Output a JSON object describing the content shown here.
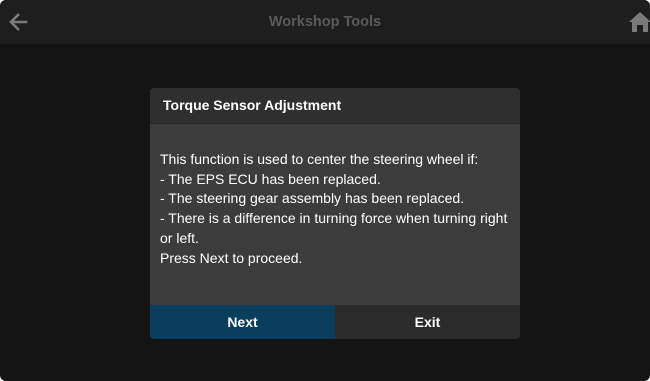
{
  "header": {
    "title": "Workshop Tools",
    "back_icon": "arrow-left-icon",
    "home_icon": "home-icon"
  },
  "dialog": {
    "title": "Torque Sensor Adjustment",
    "body_lines": [
      "This function is used to center the steering wheel if:",
      "- The EPS ECU has been replaced.",
      "- The steering gear assembly has been replaced.",
      "- There is a difference in turning force when turning right or left.",
      "Press Next to proceed."
    ],
    "buttons": {
      "next_label": "Next",
      "exit_label": "Exit"
    }
  },
  "colors": {
    "background": "#141414",
    "top_bar": "#1e1e1e",
    "dialog": "#3c3c3c",
    "dialog_header": "#2f2f2f",
    "primary_button": "#0b3d5c",
    "secondary_button": "#2b2b2b",
    "title_text": "#5a5a5a"
  }
}
